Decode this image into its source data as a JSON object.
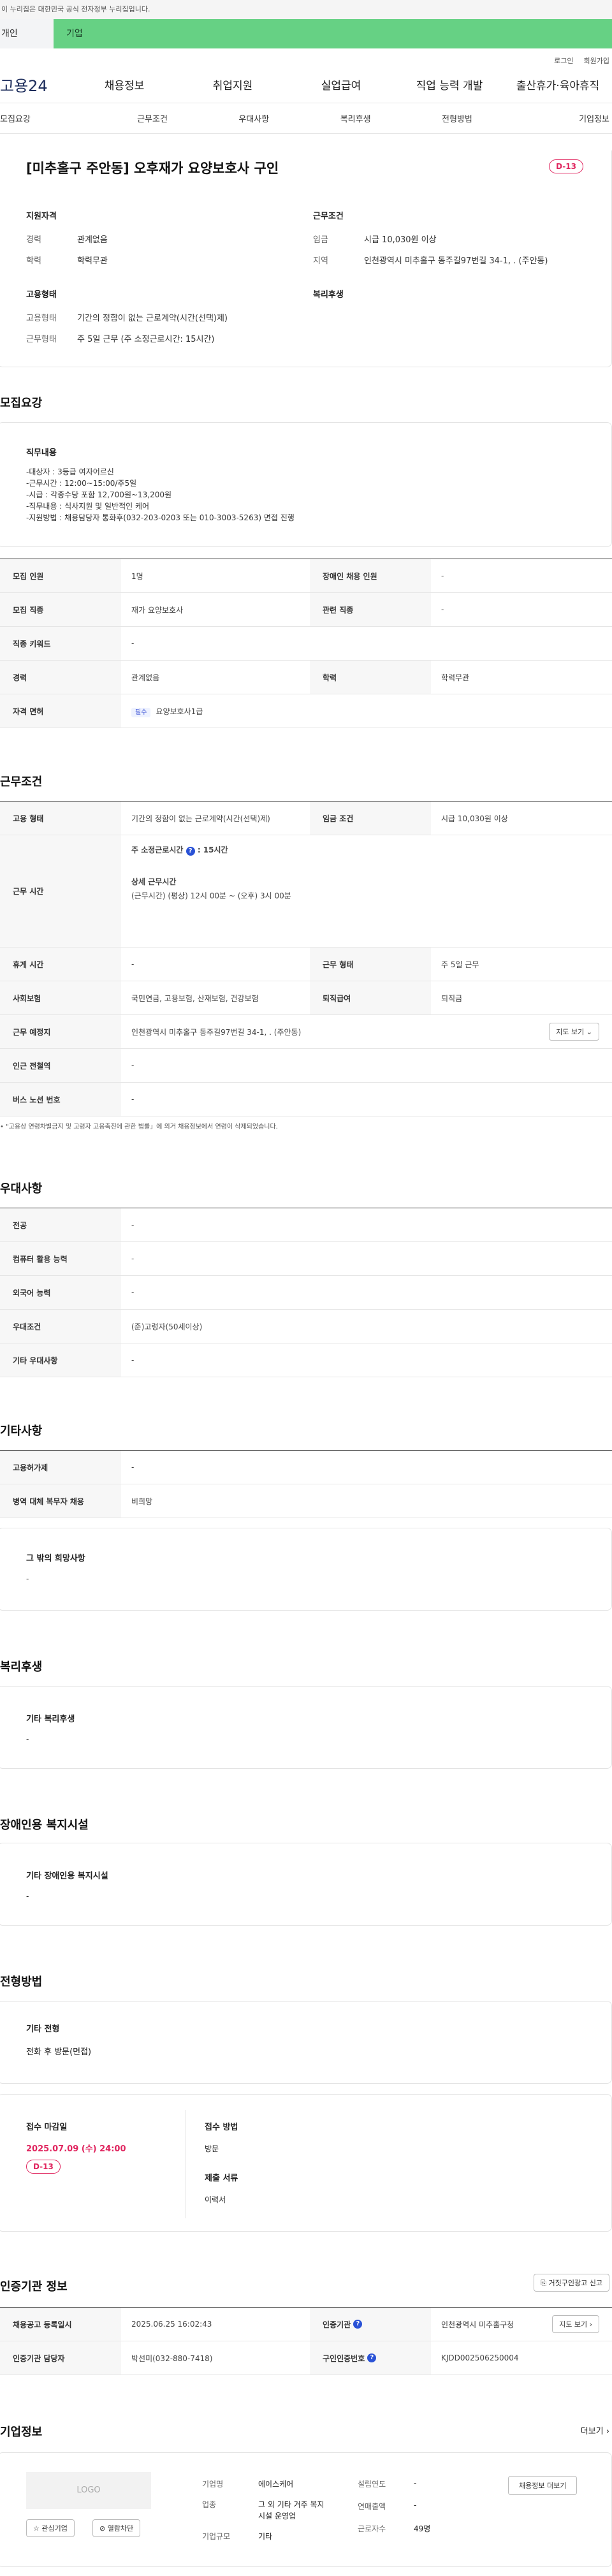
{
  "gov_banner": "이 누리집은 대한민국 공식 전자정부 누리집입니다.",
  "segment": {
    "personal": "개인",
    "company": "기업"
  },
  "util": {
    "login": "로그인",
    "join": "회원가입"
  },
  "logo": "고용24",
  "gnb": [
    "채용정보",
    "취업지원",
    "실업급여",
    "직업 능력 개발",
    "출산휴가·육아휴직"
  ],
  "lnb": [
    "모집요강",
    "근무조건",
    "우대사항",
    "복리후생",
    "전형방법",
    "기업정보"
  ],
  "summary": {
    "title": "[미추홀구 주안동] 오후재가 요양보호사 구인",
    "dday": "D-13",
    "qual_h": "지원자격",
    "career_k": "경력",
    "career_v": "관계없음",
    "edu_k": "학력",
    "edu_v": "학력무관",
    "cond_h": "근무조건",
    "wage_k": "임금",
    "wage_v": "시급 10,030원 이상",
    "region_k": "지역",
    "region_v": "인천광역시 미추홀구 동주길97번길 34-1, . (주안동)",
    "emp_h": "고용형태",
    "type_k": "고용형태",
    "type_v": "기간의 정함이 없는 근로계약(시간(선택)제)",
    "hours_k": "근무형태",
    "hours_v": "주 5일 근무 (주 소정근로시간: 15시간)",
    "welfare_h": "복리후생"
  },
  "recruit": {
    "heading": "모집요강",
    "duty_h": "직무내용",
    "duty_lines": [
      "-대상자 : 3등급 여자어르신",
      "-근무시간 : 12:00~15:00/주5일",
      "-시급 : 각종수당 포함  12,700원~13,200원",
      "-직무내용 : 식사지원 및 일반적인 케어",
      "-지원방법 : 채용담당자 통화후(032-203-0203 또는 010-3003-5263) 면접 진행"
    ],
    "rows": [
      {
        "k1": "모집 인원",
        "v1": "1명",
        "k2": "장애인 채용 인원",
        "v2": "-"
      },
      {
        "k1": "모집 직종",
        "v1": "재가 요양보호사",
        "k2": "관련 직종",
        "v2": "-"
      },
      {
        "k1": "직종 키워드",
        "v1": "-"
      },
      {
        "k1": "경력",
        "v1": "관계없음",
        "k2": "학력",
        "v2": "학력무관"
      },
      {
        "k1": "자격 면허",
        "chip": "필수",
        "v1": "요양보호사1급"
      }
    ]
  },
  "work": {
    "heading": "근무조건",
    "r1": {
      "k1": "고용 형태",
      "v1": "기간의 정함이 없는 근로계약(시간(선택)제)",
      "k2": "임금 조건",
      "v2": "시급 10,030원 이상"
    },
    "hours_k": "근무 시간",
    "week_label": "주 소정근로시간",
    "week_val": ": 15시간",
    "detail_label": "상세 근무시간",
    "detail_val": "(근무시간) (평상) 12시 00분 ~ (오후) 3시 00분",
    "r3": {
      "k1": "휴게 시간",
      "v1": "-",
      "k2": "근무 형태",
      "v2": "주 5일 근무"
    },
    "r4": {
      "k1": "사회보험",
      "v1": "국민연금, 고용보험, 산재보험, 건강보험",
      "k2": "퇴직급여",
      "v2": "퇴직금"
    },
    "r5": {
      "k1": "근무 예정지",
      "v1": "인천광역시 미추홀구 동주길97번길 34-1, . (주안동)",
      "btn": "지도 보기"
    },
    "r6": {
      "k1": "인근 전철역",
      "v1": "-"
    },
    "r7": {
      "k1": "버스 노선 번호",
      "v1": "-"
    },
    "note": "\"고용상 연령차별금지 및 고령자 고용촉진에 관한 법률」에 의거 채용정보에서 연령이 삭제되었습니다."
  },
  "pref": {
    "heading": "우대사항",
    "rows": [
      {
        "k": "전공",
        "v": "-"
      },
      {
        "k": "컴퓨터 활용 능력",
        "v": "-"
      },
      {
        "k": "외국어 능력",
        "v": "-"
      },
      {
        "k": "우대조건",
        "v": "(준)고령자(50세이상)"
      },
      {
        "k": "기타 우대사항",
        "v": "-"
      }
    ]
  },
  "etc": {
    "heading": "기타사항",
    "rows": [
      {
        "k": "고용허가제",
        "v": "-"
      },
      {
        "k": "병역 대체 복무자 채용",
        "v": "비희망"
      }
    ],
    "box_h": "그 밖의 희망사항",
    "box_v": "-"
  },
  "welfare": {
    "heading": "복리후생",
    "box_h": "기타 복리후생",
    "box_v": "-"
  },
  "disabled": {
    "heading": "장애인용 복지시설",
    "box_h": "기타 장애인용 복지시설",
    "box_v": "-"
  },
  "screen": {
    "heading": "전형방법",
    "box_h": "기타 전형",
    "box_v": "전화 후 방문(면접)",
    "deadline_h": "접수 마감일",
    "deadline_v": "2025.07.09 (수) 24:00",
    "dday": "D-13",
    "method_h": "접수 방법",
    "method_v": "방문",
    "docs_h": "제출 서류",
    "docs_v": "이력서"
  },
  "agency": {
    "heading": "인증기관 정보",
    "report_btn": "거짓구인광고 신고",
    "r1": {
      "k1": "채용공고 등록일시",
      "v1": "2025.06.25 16:02:43",
      "k2": "인증기관",
      "v2": "인천광역시 미추홀구청",
      "btn": "지도 보기"
    },
    "r2": {
      "k1": "인증기관 담당자",
      "v1": "박선미(032-880-7418)",
      "k2": "구인인증번호",
      "v2": "KJDD002506250004"
    }
  },
  "company": {
    "heading": "기업정보",
    "more": "더보기",
    "logo": "LOGO",
    "fav": "관심기업",
    "block": "열람차단",
    "name_k": "기업명",
    "name_v": "에이스케어",
    "ind_k": "업종",
    "ind_v": "그 외 기타 거주 복지시설 운영업",
    "size_k": "기업규모",
    "size_v": "기타",
    "year_k": "설립연도",
    "year_v": "-",
    "rev_k": "연매출액",
    "rev_v": "-",
    "emp_k": "근로자수",
    "emp_v": "49명",
    "jobs_btn": "채용정보 더보기"
  }
}
